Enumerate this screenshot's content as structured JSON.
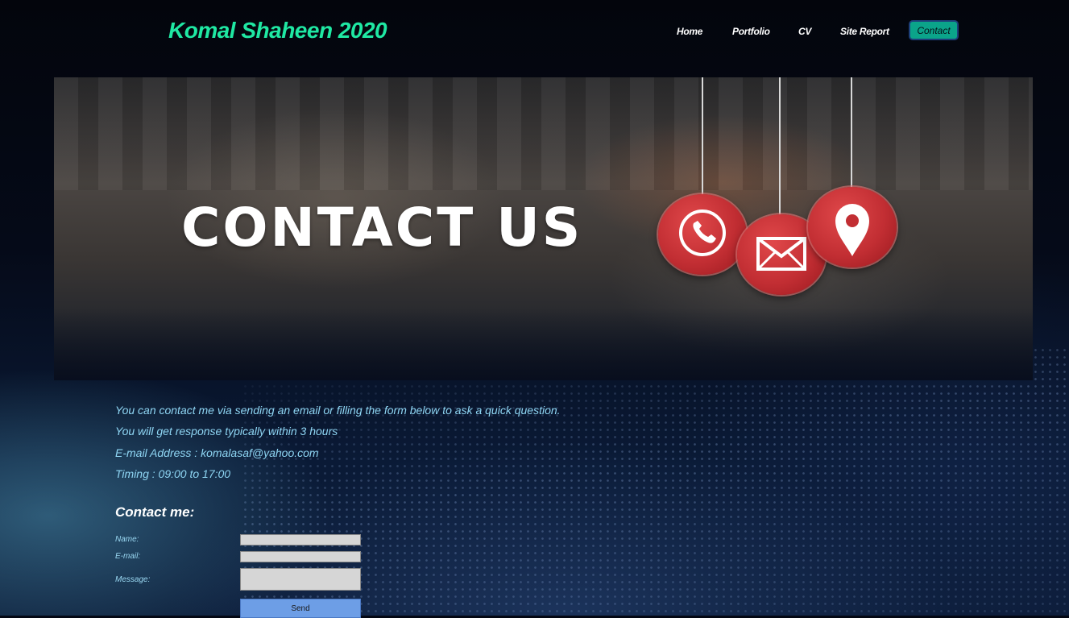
{
  "header": {
    "brand": "Komal Shaheen 2020",
    "nav": [
      {
        "label": "Home"
      },
      {
        "label": "Portfolio"
      },
      {
        "label": "CV"
      },
      {
        "label": "Site Report"
      },
      {
        "label": "Contact"
      }
    ],
    "active": "Contact"
  },
  "banner": {
    "title": "CONTACT US",
    "icons": [
      "phone-icon",
      "mail-icon",
      "location-pin-icon"
    ]
  },
  "info": {
    "line1": "You can contact me via sending an email or filling the form below to ask a quick question.",
    "line2": "You will get response typically within 3 hours",
    "line3": "E-mail Address : komalasaf@yahoo.com",
    "line4": "Timing : 09:00 to 17:00"
  },
  "form": {
    "heading": "Contact me:",
    "name_label": "Name:",
    "email_label": "E-mail:",
    "message_label": "Message:",
    "name_value": "",
    "email_value": "",
    "message_value": "",
    "send_label": "Send"
  },
  "colors": {
    "brand": "#1fe8a3",
    "active_tab": "#0ba48a",
    "info_text": "#8fd6f4",
    "badge_red": "#c22e33",
    "send_button": "#6d9ee6"
  }
}
